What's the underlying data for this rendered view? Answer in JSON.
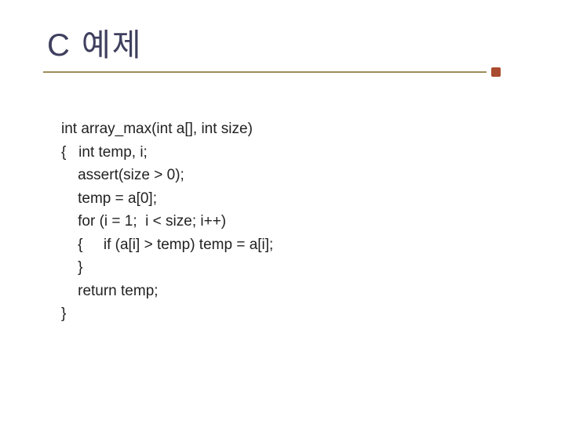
{
  "title": "C 예제",
  "code": {
    "line1": "int array_max(int a[], int size)",
    "line2": "{   int temp, i;",
    "line3": "    assert(size > 0);",
    "line4": "    temp = a[0];",
    "line5": "    for (i = 1;  i < size; i++)",
    "line6": "    {     if (a[i] > temp) temp = a[i];",
    "line7": "    }",
    "line8": "    return temp;",
    "line9": "}"
  }
}
